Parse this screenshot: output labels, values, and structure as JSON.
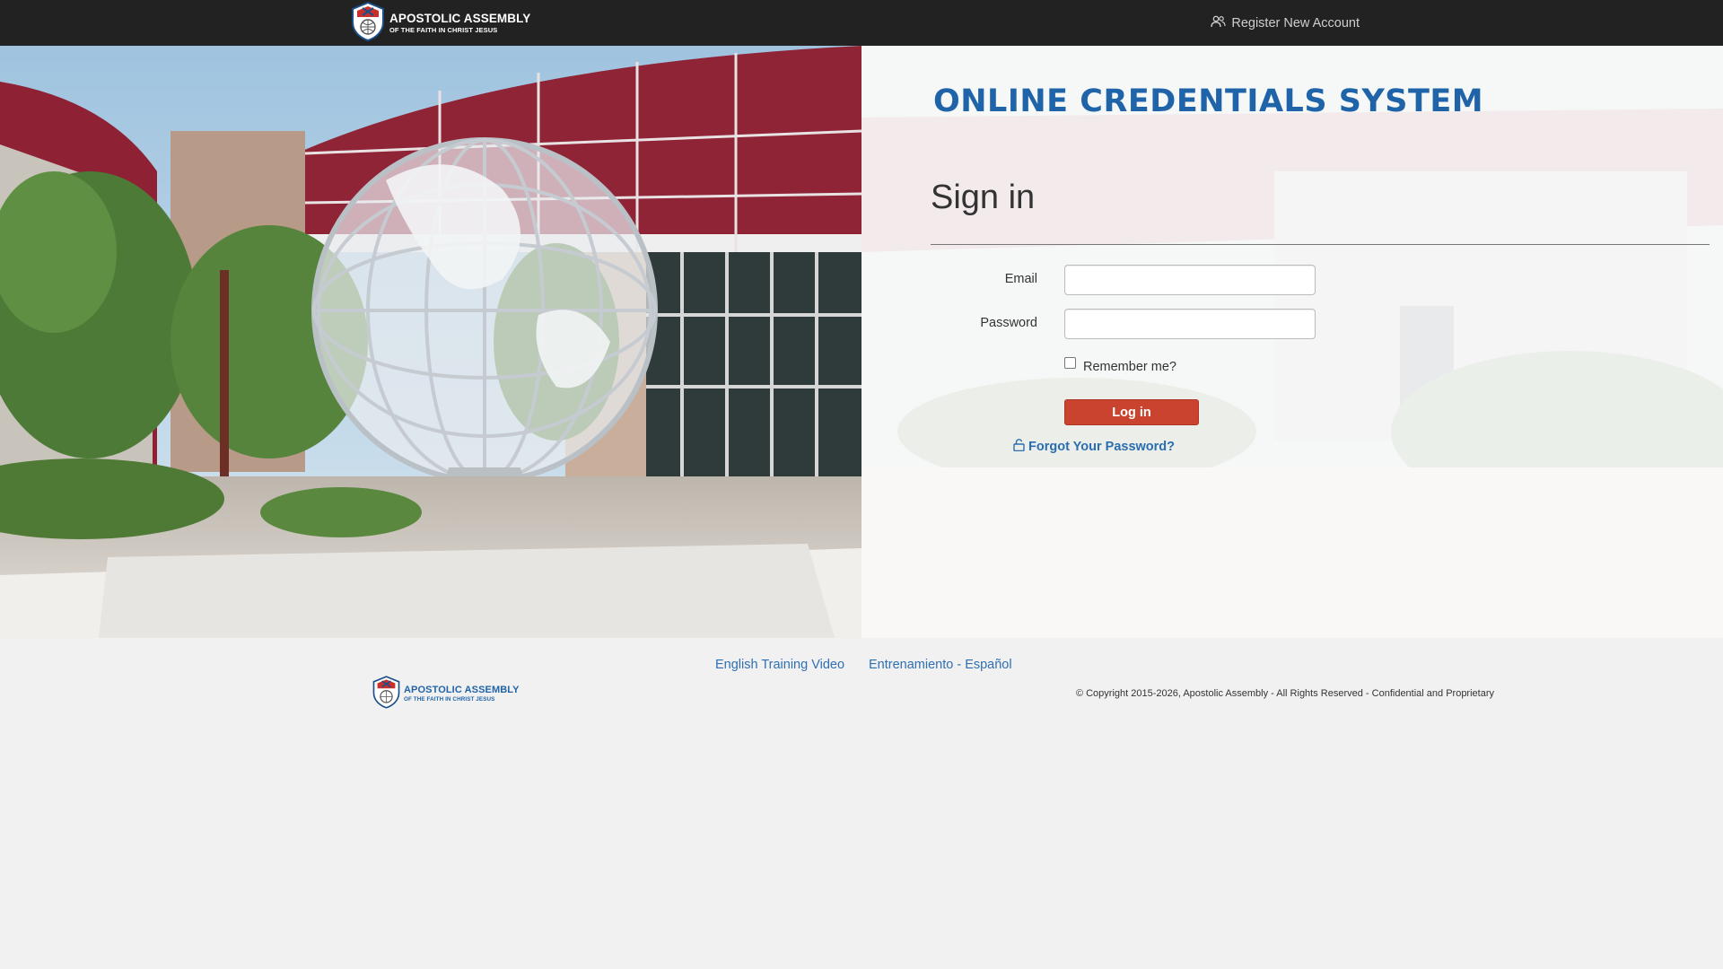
{
  "navbar": {
    "logo": {
      "line1": "APOSTOLIC ASSEMBLY",
      "line2": "OF THE FAITH IN CHRIST JESUS",
      "icon": "shield-emblem-icon"
    },
    "register_link": {
      "label": "Register New Account",
      "icon": "users-icon"
    }
  },
  "hero": {
    "system_title": "ONLINE CREDENTIALS SYSTEM",
    "signin": {
      "heading": "Sign in",
      "email_label": "Email",
      "email_value": "",
      "password_label": "Password",
      "password_value": "",
      "remember_label": "Remember me?",
      "remember_checked": false,
      "login_button": "Log in",
      "forgot_link": "Forgot Your Password?",
      "forgot_icon": "unlock-icon"
    }
  },
  "footer": {
    "links": [
      "English Training Video",
      "Entrenamiento - Español"
    ],
    "logo": {
      "line1": "APOSTOLIC ASSEMBLY",
      "line2": "OF THE FAITH IN CHRIST JESUS"
    },
    "copyright": "© Copyright 2015-2026, Apostolic Assembly - All Rights Reserved - Confidential and Proprietary"
  },
  "colors": {
    "navbar_bg": "#222222",
    "title_blue": "#1f64a8",
    "login_red": "#c9432f",
    "link_blue": "#2f6fb3",
    "page_bg": "#f1f1f1"
  }
}
